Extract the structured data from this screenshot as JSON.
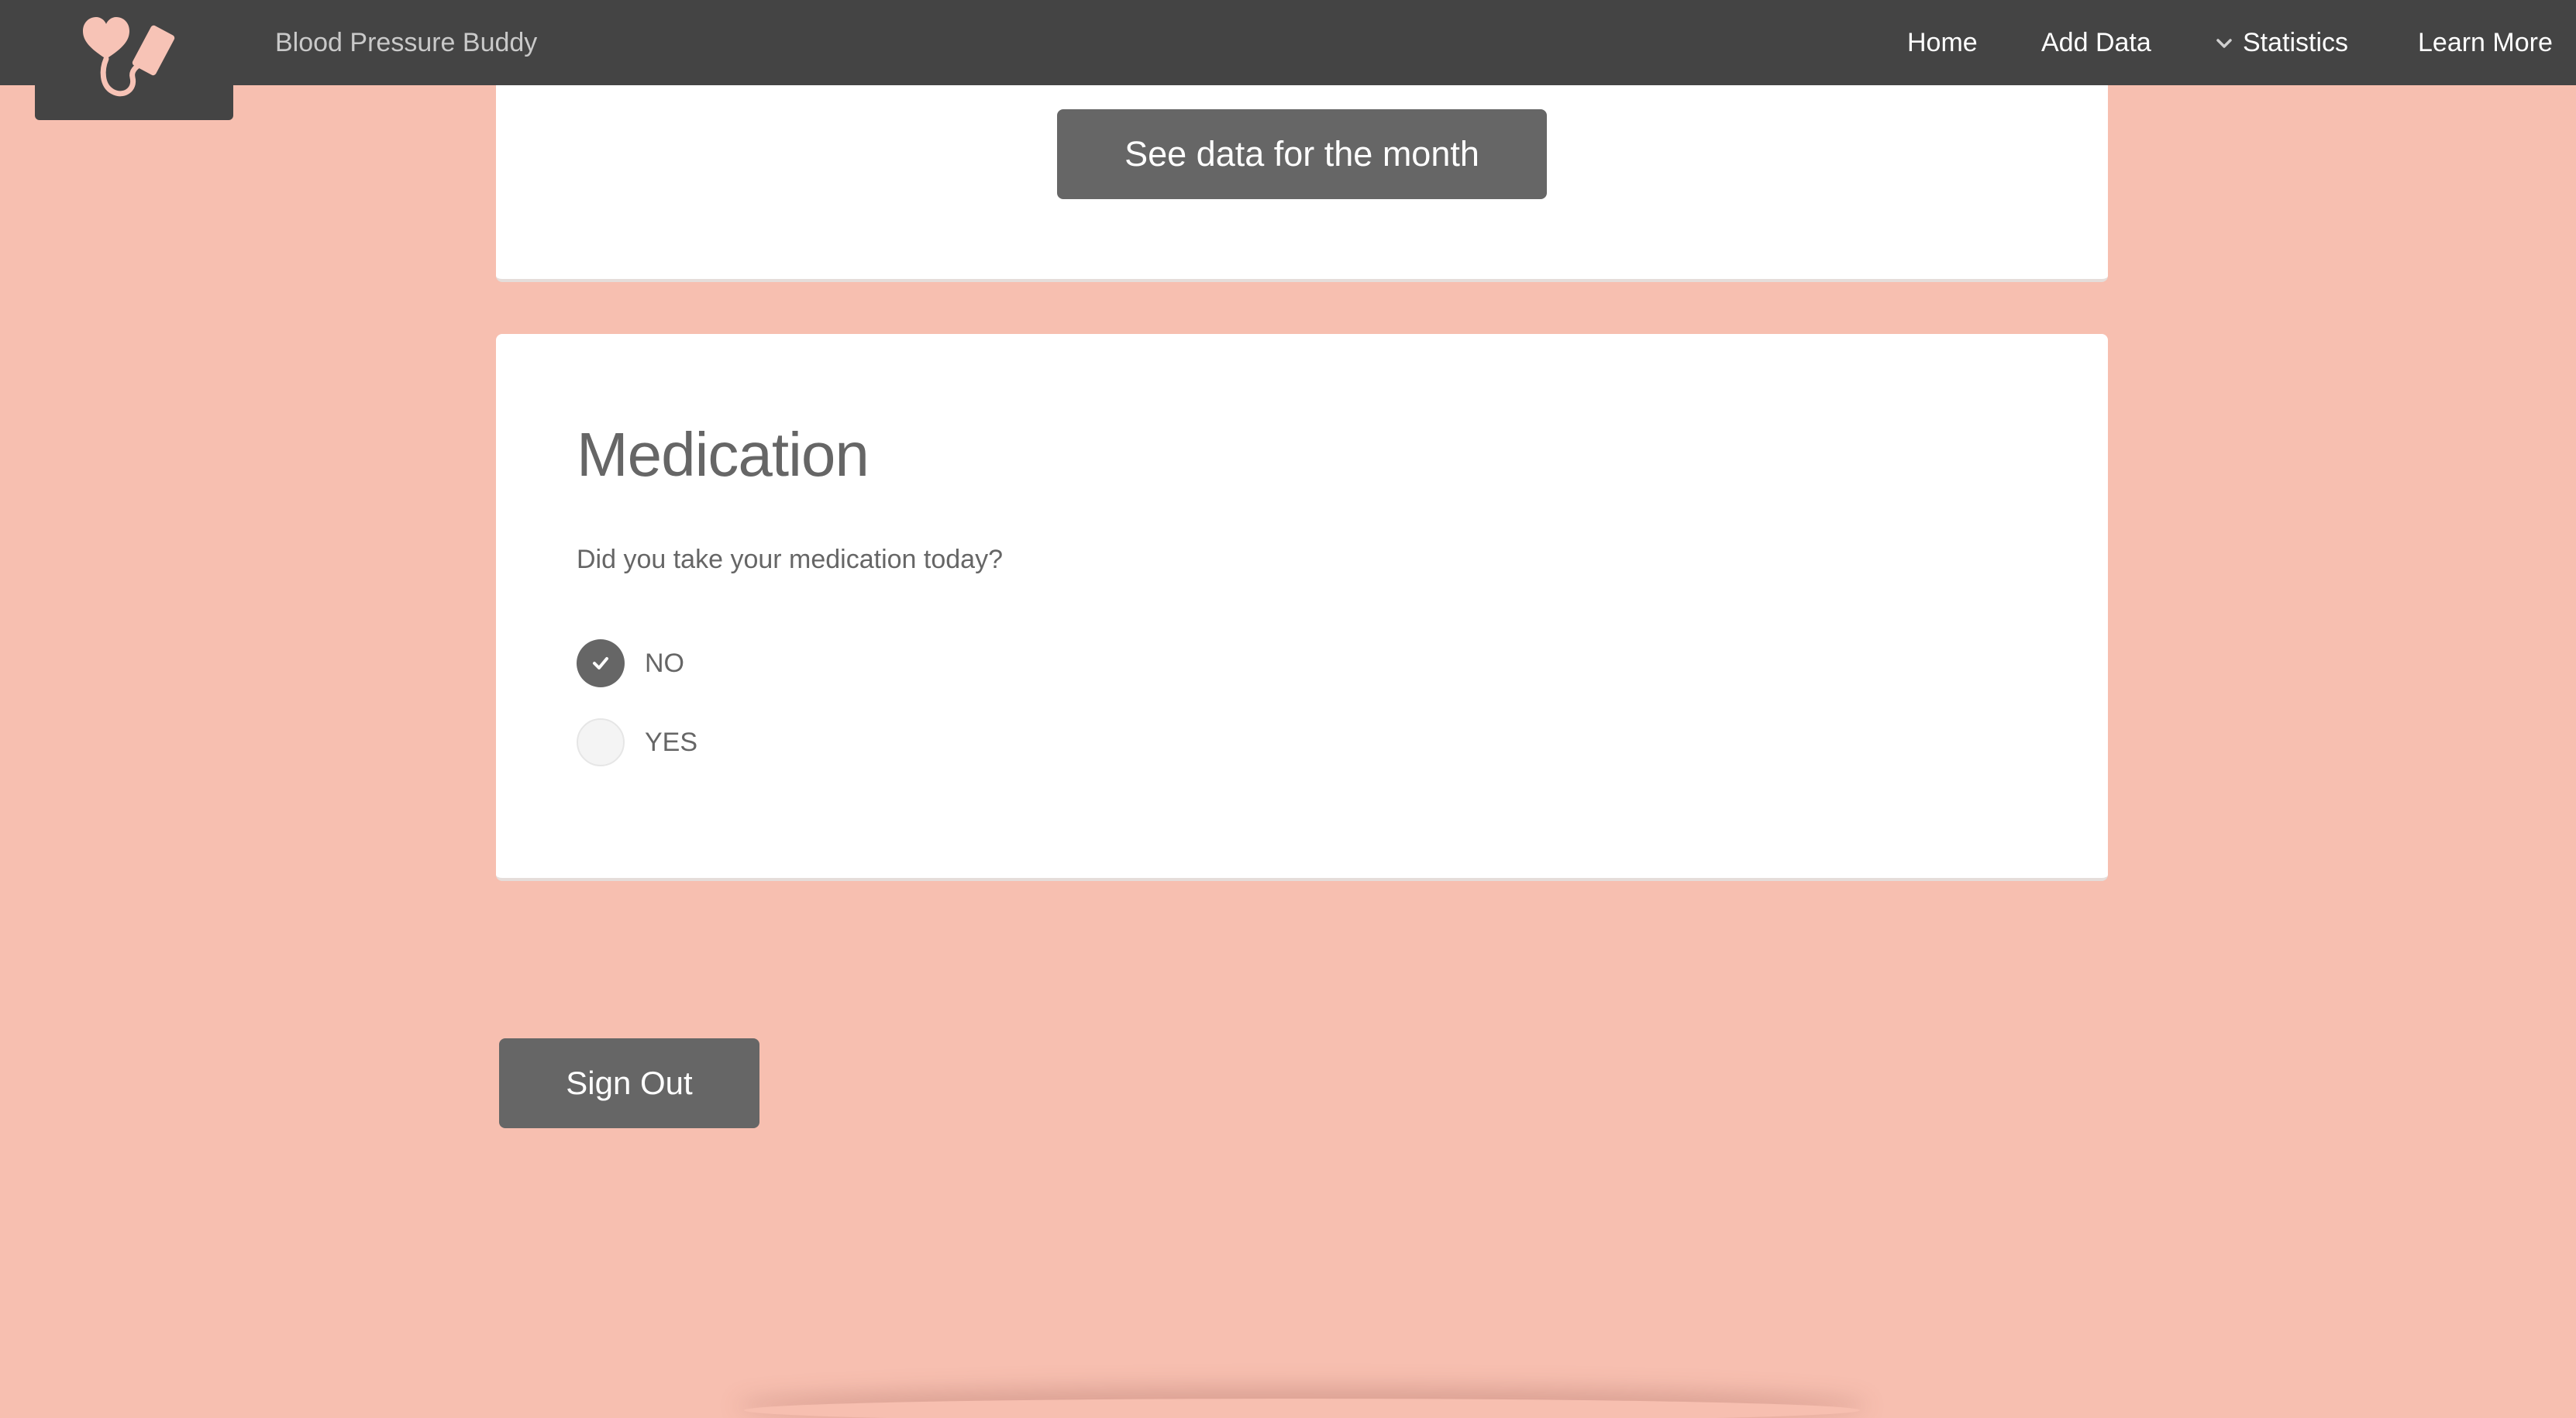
{
  "app": {
    "brand_name": "Blood Pressure Buddy",
    "logo_icon": "heart-cuff-icon"
  },
  "nav": {
    "items": [
      {
        "label": "Home"
      },
      {
        "label": "Add Data"
      },
      {
        "label": "Statistics",
        "icon": "chevron-down-icon"
      },
      {
        "label": "Learn More"
      }
    ]
  },
  "month_card": {
    "button_label": "See data for the month"
  },
  "medication": {
    "title": "Medication",
    "question": "Did you take your medication today?",
    "options": [
      {
        "label": "NO",
        "checked": true
      },
      {
        "label": "YES",
        "checked": false
      }
    ]
  },
  "signout": {
    "label": "Sign Out"
  },
  "colors": {
    "page_background": "#f7bfb0",
    "navbar": "#444444",
    "logo_accent": "#f7c3b6",
    "button": "#666666",
    "card": "#ffffff",
    "text": "#666666"
  }
}
